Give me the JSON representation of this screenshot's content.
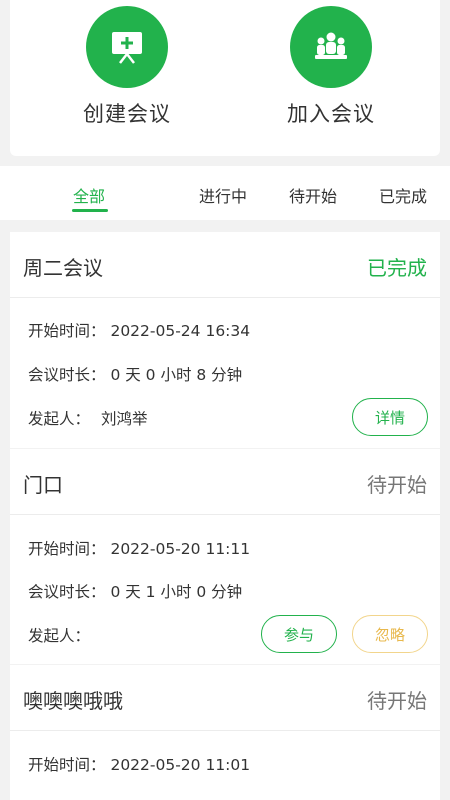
{
  "actions": {
    "create_label": "创建会议",
    "join_label": "加入会议"
  },
  "tabs": [
    "全部",
    "进行中",
    "待开始",
    "已完成"
  ],
  "meetings": [
    {
      "title": "周二会议",
      "status": "已完成",
      "start_label": "开始时间：",
      "start_time": "2022-05-24 16:34",
      "duration_label": "会议时长：",
      "duration": "0 天 0 小时 8 分钟",
      "initiator_label": "发起人：",
      "initiator": "刘鸿举",
      "details_button": "详情"
    },
    {
      "title": "门口",
      "status": "待开始",
      "start_label": "开始时间：",
      "start_time": "2022-05-20 11:11",
      "duration_label": "会议时长：",
      "duration": "0 天 1 小时 0 分钟",
      "initiator_label": "发起人：",
      "initiator": "",
      "join_button": "参与",
      "ignore_button": "忽略"
    },
    {
      "title": "噢噢噢哦哦",
      "status": "待开始",
      "start_label": "开始时间：",
      "start_time": "2022-05-20 11:01"
    }
  ],
  "colors": {
    "accent": "#22b24c",
    "ignore": "#e8b84c",
    "pending": "#777777"
  }
}
